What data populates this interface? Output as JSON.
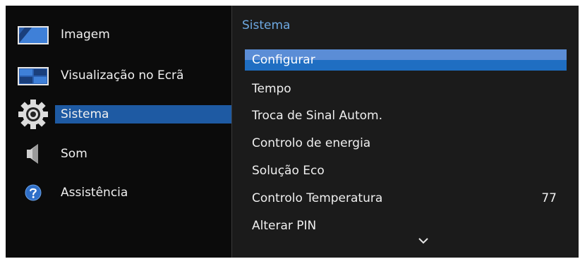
{
  "menu": {
    "items": [
      {
        "label": "Imagem",
        "icon": "picture-icon",
        "active": false
      },
      {
        "label": "Visualização no Ecrã",
        "icon": "onscreen-display-icon",
        "active": false
      },
      {
        "label": "Sistema",
        "icon": "gear-icon",
        "active": true
      },
      {
        "label": "Som",
        "icon": "speaker-icon",
        "active": false
      },
      {
        "label": "Assistência",
        "icon": "help-icon",
        "active": false
      }
    ]
  },
  "panel": {
    "title": "Sistema",
    "items": [
      {
        "label": "Configurar",
        "value": "",
        "selected": true
      },
      {
        "label": "Tempo",
        "value": ""
      },
      {
        "label": "Troca de Sinal Autom.",
        "value": ""
      },
      {
        "label": "Controlo de energia",
        "value": ""
      },
      {
        "label": "Solução Eco",
        "value": ""
      },
      {
        "label": "Controlo Temperatura",
        "value": "77"
      },
      {
        "label": "Alterar PIN",
        "value": ""
      }
    ],
    "more_icon": "chevron-down-icon"
  },
  "colors": {
    "accent": "#1e5aa3",
    "selection": "#5b8dd6",
    "title": "#6ea9e2",
    "panel_bg": "#1b1b1b",
    "screen_bg": "#0b0b0b"
  }
}
